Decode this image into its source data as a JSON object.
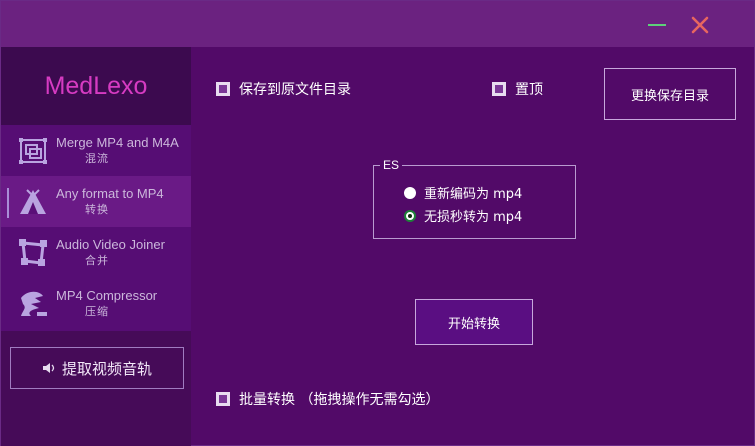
{
  "window": {
    "title": "",
    "min_icon": "minimize-icon",
    "close_icon": "close-icon",
    "min_color": "#5ecf7a",
    "close_color": "#e8665f"
  },
  "sidebar": {
    "brand": "MedLexo",
    "items": [
      {
        "en": "Merge MP4 and M4A",
        "zh": "混流",
        "icon": "merge-icon",
        "active": false
      },
      {
        "en": "Any format to MP4",
        "zh": "转换",
        "icon": "tent-icon",
        "active": true
      },
      {
        "en": "Audio Video Joiner",
        "zh": "合并",
        "icon": "frame-icon",
        "active": false
      },
      {
        "en": "MP4 Compressor",
        "zh": "压缩",
        "icon": "compress-icon",
        "active": false
      }
    ],
    "extract_button": "提取视频音轨",
    "extract_icon": "speaker-icon"
  },
  "main": {
    "save_to_original": "保存到原文件目录",
    "pin_top": "置顶",
    "change_dir_button": "更换保存目录",
    "group_label": "ES",
    "radio_reencode": "重新编码为 mp4",
    "radio_lossless": "无损秒转为 mp4",
    "start_button": "开始转换",
    "batch_convert": "批量转换 （拖拽操作无需勾选）"
  }
}
